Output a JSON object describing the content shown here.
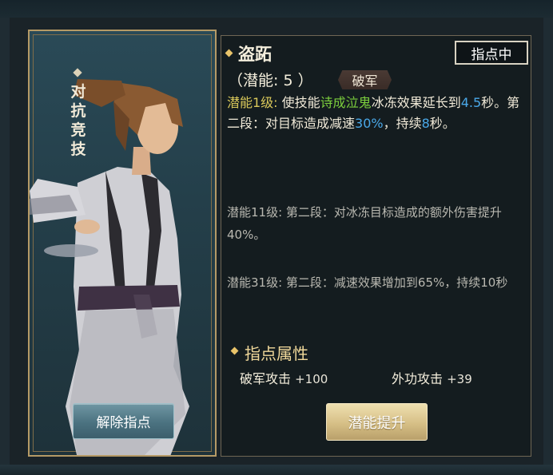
{
  "card": {
    "vertical_title": [
      "对",
      "抗",
      "竞",
      "技"
    ],
    "release_button": "解除指点"
  },
  "skill": {
    "name": "盗跖",
    "potential_label": "（潜能: 5 ）",
    "tag": "破军",
    "pointed_button": "指点中",
    "desc1": {
      "level_label": "潜能1级:",
      "t1": " 使技能",
      "skill_ref": "诗成泣鬼",
      "t2": "冰冻效果延长到",
      "v1": "4.5",
      "t3": "秒。第二段：对目标造成减速",
      "v2": "30%",
      "t4": "，持续",
      "v3": "8",
      "t5": "秒。"
    },
    "desc2": "潜能11级: 第二段：对冰冻目标造成的额外伤害提升40%。",
    "desc3": "潜能31级: 第二段：减速效果增加到65%，持续10秒"
  },
  "attributes": {
    "title": "指点属性",
    "items": [
      {
        "name": "破军攻击",
        "value": "+100"
      },
      {
        "name": "外功攻击",
        "value": "+39"
      }
    ]
  },
  "upgrade_button": "潜能提升",
  "colors": {
    "accent_gold": "#e9c46a",
    "highlight_green": "#7ccf3d",
    "highlight_blue": "#4aa8e8"
  }
}
